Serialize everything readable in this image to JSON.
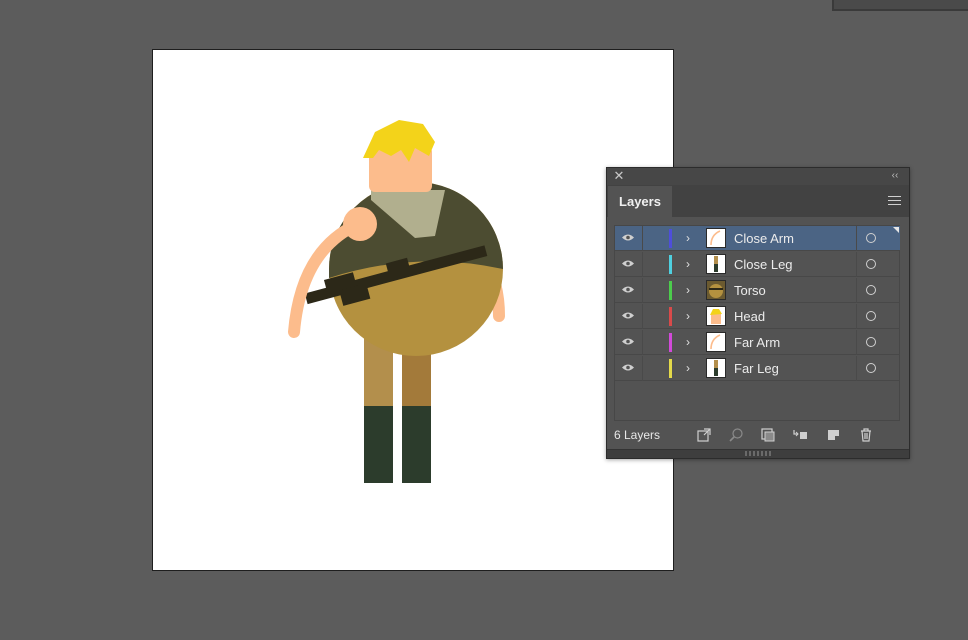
{
  "panel": {
    "tab_label": "Layers",
    "close_glyph": "✕",
    "collapse_glyph": "‹‹",
    "layer_count_label": "6 Layers"
  },
  "layers": [
    {
      "name": "Close Arm",
      "color": "#4e4edb",
      "selected": true,
      "thumb": "arm"
    },
    {
      "name": "Close Leg",
      "color": "#4fd0e0",
      "selected": false,
      "thumb": "leg"
    },
    {
      "name": "Torso",
      "color": "#4ccc4c",
      "selected": false,
      "thumb": "torso"
    },
    {
      "name": "Head",
      "color": "#d94a4a",
      "selected": false,
      "thumb": "head"
    },
    {
      "name": "Far Arm",
      "color": "#d24ad9",
      "selected": false,
      "thumb": "arm"
    },
    {
      "name": "Far Leg",
      "color": "#e3d94a",
      "selected": false,
      "thumb": "leg"
    }
  ],
  "footer_icons": [
    "export-icon",
    "search-icon",
    "clipping-mask-icon",
    "move-selection-icon",
    "new-sublayer-icon",
    "new-layer-icon",
    "delete-icon"
  ],
  "colors": {
    "canvas_bg": "#5c5c5c",
    "selection_blue": "#4b6484",
    "hair": "#f3d31a",
    "skin": "#fcbc8c",
    "torso": "#b4913f",
    "jacket": "#4c4c31",
    "scarf": "#b1af8e",
    "pants": "#b38f4c",
    "boots": "#2c3c2c",
    "rifle": "#2c2818"
  }
}
